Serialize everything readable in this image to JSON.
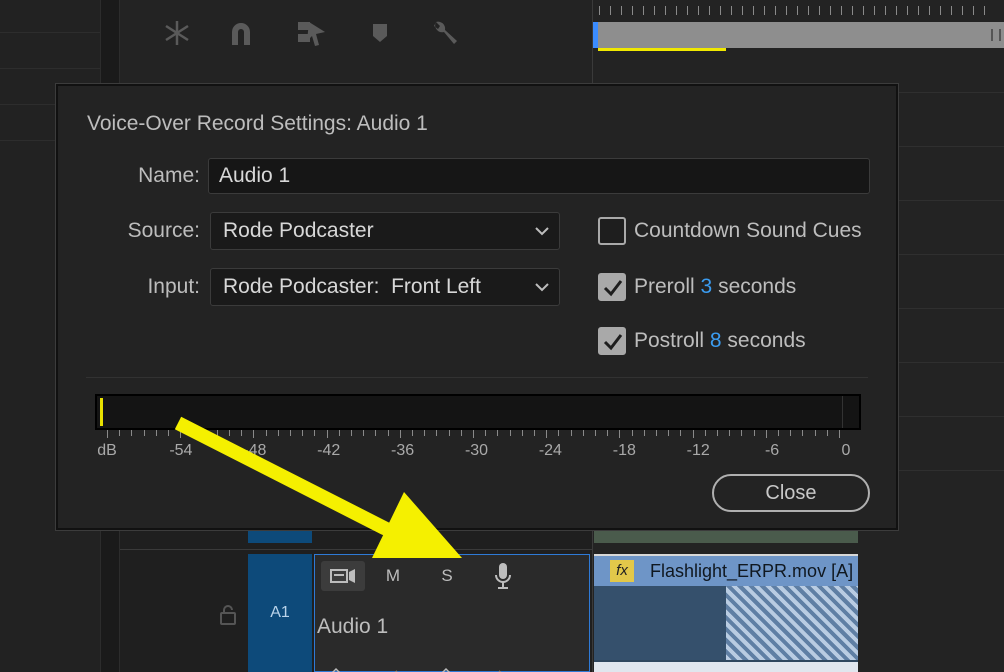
{
  "dialog": {
    "title": "Voice-Over Record Settings: Audio 1",
    "name_label": "Name:",
    "name_value": "Audio 1",
    "source_label": "Source:",
    "source_value": "Rode Podcaster",
    "input_label": "Input:",
    "input_value": "Rode Podcaster:  Front Left",
    "countdown_label": "Countdown Sound Cues",
    "countdown_checked": false,
    "preroll": {
      "prefix": "Preroll",
      "value": "3",
      "suffix": "seconds",
      "checked": true
    },
    "postroll": {
      "prefix": "Postroll",
      "value": "8",
      "suffix": "seconds",
      "checked": true
    },
    "meter_scale": [
      "dB",
      "-54",
      "-48",
      "-42",
      "-36",
      "-30",
      "-24",
      "-18",
      "-12",
      "-6",
      "0"
    ],
    "close_label": "Close"
  },
  "track": {
    "id_label": "A1",
    "name": "Audio 1",
    "buttons": [
      "M",
      "S"
    ],
    "icons": [
      "track-output-icon",
      "microphone-icon",
      "lock-icon"
    ]
  },
  "clip": {
    "fx_label": "fx",
    "name": "Flashlight_ERPR.mov [A]"
  },
  "toolbar": {
    "icons": [
      "ripple-edit-icon",
      "snap-magnet-icon",
      "linked-selection-icon",
      "marker-icon",
      "wrench-icon"
    ]
  },
  "colors": {
    "accent_blue": "#3b9cf0",
    "track_blue": "#0d4a7a",
    "annotation_arrow": "#f5f000",
    "clip_header": "#6e95c7"
  }
}
